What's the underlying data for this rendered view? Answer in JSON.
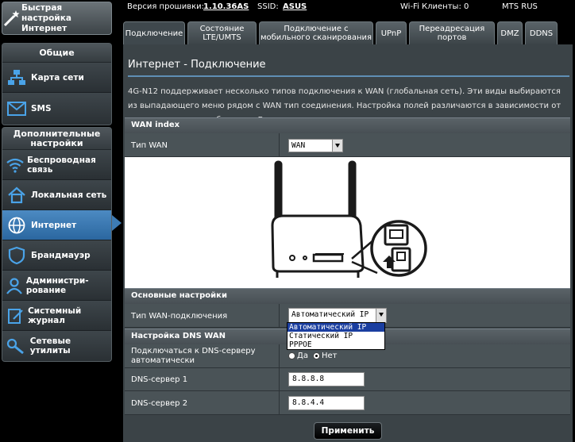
{
  "sidebar": {
    "quick_setup": "Быстрая настройка Интернет",
    "general": {
      "title": "Общие",
      "items": [
        {
          "label": "Карта сети",
          "icon": "network-map-icon"
        },
        {
          "label": "SMS",
          "icon": "sms-icon"
        }
      ]
    },
    "advanced": {
      "title": "Дополнительные настройки",
      "items": [
        {
          "label": "Беспроводная связь",
          "icon": "wireless-icon"
        },
        {
          "label": "Локальная сеть",
          "icon": "lan-icon"
        },
        {
          "label": "Интернет",
          "icon": "globe-icon",
          "active": true
        },
        {
          "label": "Брандмауэр",
          "icon": "firewall-icon"
        },
        {
          "label": "Администри-рование",
          "icon": "admin-icon"
        },
        {
          "label": "Системный журнал",
          "icon": "syslog-icon"
        },
        {
          "label": "Сетевые утилиты",
          "icon": "network-tools-icon"
        }
      ]
    }
  },
  "topbar": {
    "firmware_label": "Версия прошивки:",
    "firmware_value": "1.10.36AS",
    "ssid_label": "SSID:",
    "ssid_value": "ASUS",
    "wifi_clients": "Wi-Fi Клиенты: 0",
    "operator": "MTS RUS"
  },
  "tabs": [
    "Подключение",
    "Состояние LTE/UMTS",
    "Подключение с мобильного сканирования",
    "UPnP",
    "Переадресация портов",
    "DMZ",
    "DDNS"
  ],
  "page": {
    "title": "Интернет - Подключение",
    "description": "4G-N12 поддерживает несколько типов подключения к WAN (глобальная сеть). Эти виды выбираются из выпадающего меню рядом с WAN тип соединения. Настройка полей различаются в зависимости от типа соединения, выбранного Вами."
  },
  "wan_index": {
    "section": "WAN index",
    "type_label": "Тип WAN",
    "type_value": "WAN"
  },
  "basic": {
    "section": "Основные настройки",
    "conn_type_label": "Тип WAN-подключения",
    "conn_type_value": "Автоматический IP",
    "options": [
      "Автоматический IP",
      "Статический IP",
      "PPPOE"
    ]
  },
  "dns": {
    "section": "Настройка DNS WAN",
    "auto_label": "Подключаться к DNS-серверу автоматически",
    "yes": "Да",
    "no": "Нет",
    "dns1_label": "DNS-сервер 1",
    "dns1_value": "8.8.8.8",
    "dns2_label": "DNS-сервер 2",
    "dns2_value": "8.8.4.4"
  },
  "apply_label": "Применить"
}
